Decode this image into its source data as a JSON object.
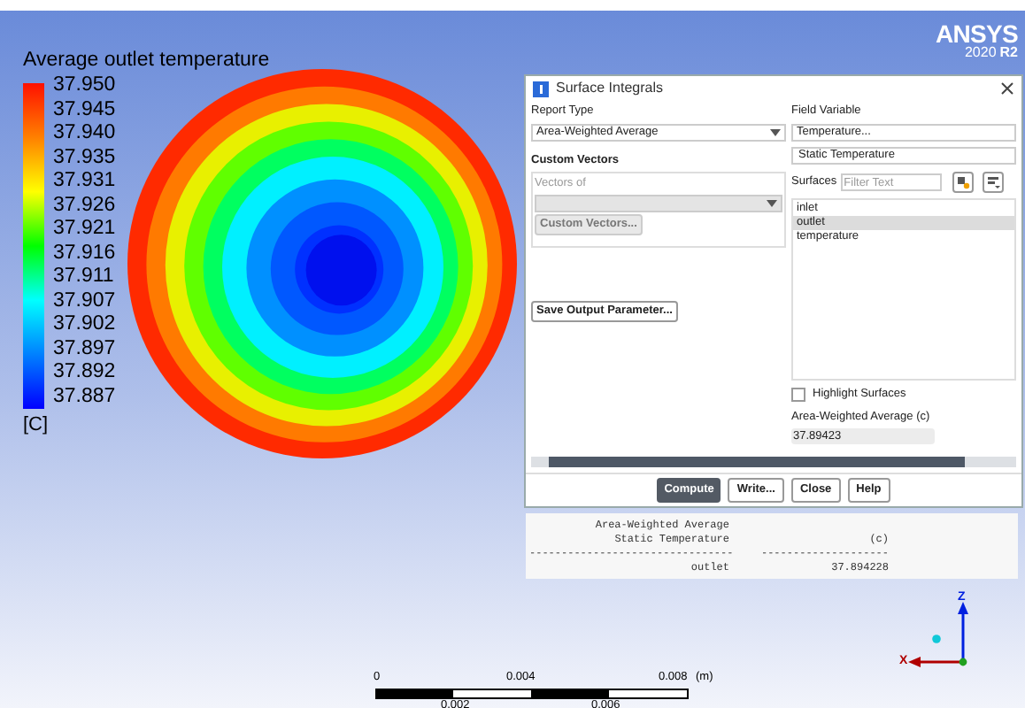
{
  "viewport": {
    "brand": "ANSYS",
    "version": "2020",
    "release": "R2"
  },
  "legend": {
    "title": "Average outlet temperature",
    "labels": [
      "37.950",
      "37.945",
      "37.940",
      "37.935",
      "37.931",
      "37.926",
      "37.921",
      "37.916",
      "37.911",
      "37.907",
      "37.902",
      "37.897",
      "37.892",
      "37.887"
    ],
    "unit": "[C]"
  },
  "dialog": {
    "title": "Surface Integrals",
    "report_type": {
      "label": "Report Type",
      "value": "Area-Weighted Average"
    },
    "custom_vectors": {
      "label": "Custom Vectors",
      "vectors_of_label": "Vectors of",
      "button": "Custom Vectors...",
      "disabled": true
    },
    "save_button": "Save Output Parameter...",
    "field_variable": {
      "label": "Field Variable",
      "value": "Temperature...",
      "sub_value": "Static Temperature"
    },
    "surfaces": {
      "label": "Surfaces",
      "placeholder": "Filter Text",
      "items": [
        {
          "label": "inlet",
          "selected": false
        },
        {
          "label": "outlet",
          "selected": true
        },
        {
          "label": "temperature",
          "selected": false
        }
      ]
    },
    "highlight": {
      "label": "Highlight Surfaces",
      "checked": false
    },
    "result": {
      "label": "Area-Weighted Average (c)",
      "value": "37.89423"
    },
    "buttons": [
      {
        "label": "Compute",
        "kind": "primary"
      },
      {
        "label": "Write...",
        "kind": "default"
      },
      {
        "label": "Close",
        "kind": "default"
      },
      {
        "label": "Help",
        "kind": "default"
      }
    ]
  },
  "console": {
    "rows": [
      {
        "cells": [
          "Area-Weighted Average",
          ""
        ]
      },
      {
        "cells": [
          "Static Temperature",
          "(c)"
        ]
      },
      {
        "cells": [
          "--------------------------------",
          "--------------------"
        ]
      },
      {
        "cells": [
          "outlet",
          "37.894228"
        ]
      }
    ]
  },
  "scale_bar": {
    "top_labels": [
      "0",
      "0.004",
      "0.008"
    ],
    "unit": "(m)",
    "bottom_labels": [
      "0.002",
      "0.006"
    ]
  },
  "triad": {
    "vertical_label": "Z",
    "horizontal_label": "X"
  }
}
